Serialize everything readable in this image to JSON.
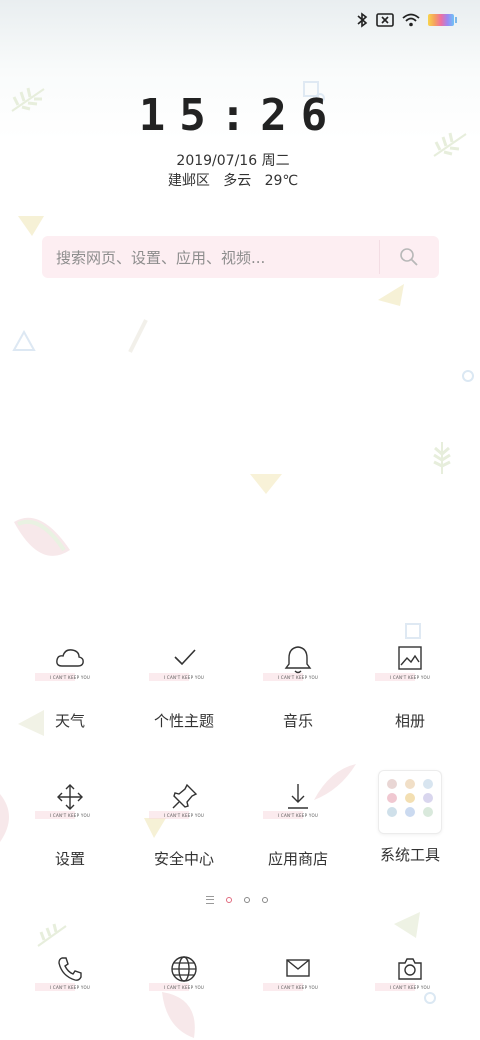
{
  "status_bar": {
    "icons": [
      "bluetooth-icon",
      "sim-no-signal-icon",
      "wifi-icon",
      "battery-icon"
    ]
  },
  "lockscreen": {
    "time": "15:26",
    "date": "2019/07/16 周二",
    "location": "建邺区",
    "weather": "多云",
    "temperature": "29℃"
  },
  "search": {
    "placeholder": "搜索网页、设置、应用、视频..."
  },
  "apps": [
    {
      "label": "天气",
      "icon": "cloud-icon",
      "tagline": "I CAN'T KEEP YOU"
    },
    {
      "label": "个性主题",
      "icon": "check-icon",
      "tagline": "I CAN'T KEEP YOU"
    },
    {
      "label": "音乐",
      "icon": "bell-icon",
      "tagline": "I CAN'T KEEP YOU"
    },
    {
      "label": "相册",
      "icon": "gallery-icon",
      "tagline": "I CAN'T KEEP YOU"
    },
    {
      "label": "设置",
      "icon": "move-arrows-icon",
      "tagline": "I CAN'T KEEP YOU"
    },
    {
      "label": "安全中心",
      "icon": "pin-icon",
      "tagline": "I CAN'T KEEP YOU"
    },
    {
      "label": "应用商店",
      "icon": "download-icon",
      "tagline": "I CAN'T KEEP YOU"
    },
    {
      "label": "系统工具",
      "icon": "folder-grid-icon"
    }
  ],
  "dock": [
    {
      "icon": "phone-icon",
      "tagline": "I CAN'T KEEP YOU"
    },
    {
      "icon": "globe-icon",
      "tagline": "I CAN'T KEEP YOU"
    },
    {
      "icon": "mail-icon",
      "tagline": "I CAN'T KEEP YOU"
    },
    {
      "icon": "camera-icon",
      "tagline": "I CAN'T KEEP YOU"
    }
  ],
  "page_indicator": {
    "pages": 3,
    "active": 1
  },
  "colors": {
    "accent": "#e06a7e",
    "search_bg": "#fdeef2"
  }
}
